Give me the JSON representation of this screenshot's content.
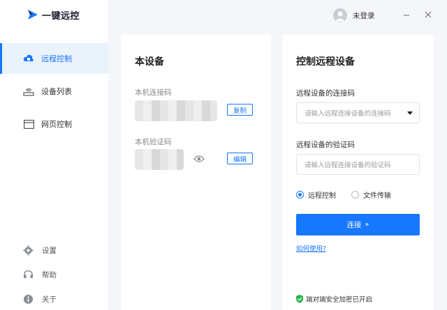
{
  "app": {
    "name": "一键远控"
  },
  "sidebar": {
    "items": [
      {
        "label": "远程控制",
        "icon": "cloud-remote-icon",
        "active": true
      },
      {
        "label": "设备列表",
        "icon": "device-list-icon",
        "active": false
      },
      {
        "label": "网页控制",
        "icon": "browser-window-icon",
        "active": false
      }
    ],
    "bottom": [
      {
        "label": "设置",
        "icon": "gear-icon"
      },
      {
        "label": "帮助",
        "icon": "headset-icon"
      },
      {
        "label": "关于",
        "icon": "info-icon"
      }
    ]
  },
  "titlebar": {
    "user_label": "未登录"
  },
  "this_device": {
    "title": "本设备",
    "code_label": "本机连接码",
    "copy_label": "复制",
    "verify_label": "本机验证码",
    "edit_label": "编辑"
  },
  "remote": {
    "title": "控制远程设备",
    "code_label": "远程设备的连接码",
    "code_placeholder": "请输入远程连接设备的连接码",
    "verify_label": "远程设备的验证码",
    "verify_placeholder": "请输入远程连接设备的验证码",
    "mode_remote": "远程控制",
    "mode_file": "文件传输",
    "connect_label": "连接",
    "help_label": "如何使用?",
    "secure_label": "端对端安全加密已开启"
  },
  "colors": {
    "accent": "#1677ff",
    "secure": "#2bb34a"
  }
}
